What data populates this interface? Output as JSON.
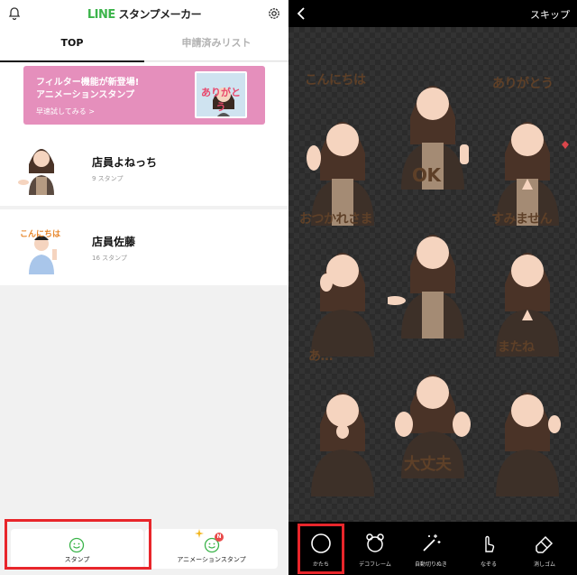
{
  "left": {
    "app_title_brand": "LINE",
    "app_title_rest": "スタンプメーカー",
    "tabs": [
      {
        "label": "TOP",
        "active": true
      },
      {
        "label": "申請済みリスト",
        "active": false
      }
    ],
    "banner": {
      "line1": "フィルター機能が新登場!",
      "line2": "アニメーションスタンプ",
      "cta": "早速試してみる >",
      "thumb_text": "ありがとう"
    },
    "sets": [
      {
        "name": "店員よねっち",
        "count": "9 スタンプ"
      },
      {
        "name": "店員佐藤",
        "count": "16 スタンプ",
        "sticker_text": "こんにちは"
      }
    ],
    "bottom": {
      "stamp_label": "スタンプ",
      "anim_label": "アニメーションスタンプ",
      "badge": "N"
    }
  },
  "right": {
    "skip_label": "スキップ",
    "captions": [
      "こんにちは",
      "ありがとう",
      "OK",
      "おつかれさま",
      "すみません",
      "あ…",
      "またね",
      "大丈夫"
    ],
    "tools": [
      {
        "label": "かたち",
        "icon": "circle-icon"
      },
      {
        "label": "デコフレーム",
        "icon": "bear-frame-icon"
      },
      {
        "label": "自動切りぬき",
        "icon": "magic-wand-icon"
      },
      {
        "label": "なぞる",
        "icon": "finger-icon"
      },
      {
        "label": "消しゴム",
        "icon": "eraser-icon"
      }
    ]
  },
  "colors": {
    "line_green": "#3bb44a",
    "banner_pink": "#e58fbc",
    "highlight_red": "#e8262b",
    "caption_brown": "#5e4028"
  }
}
